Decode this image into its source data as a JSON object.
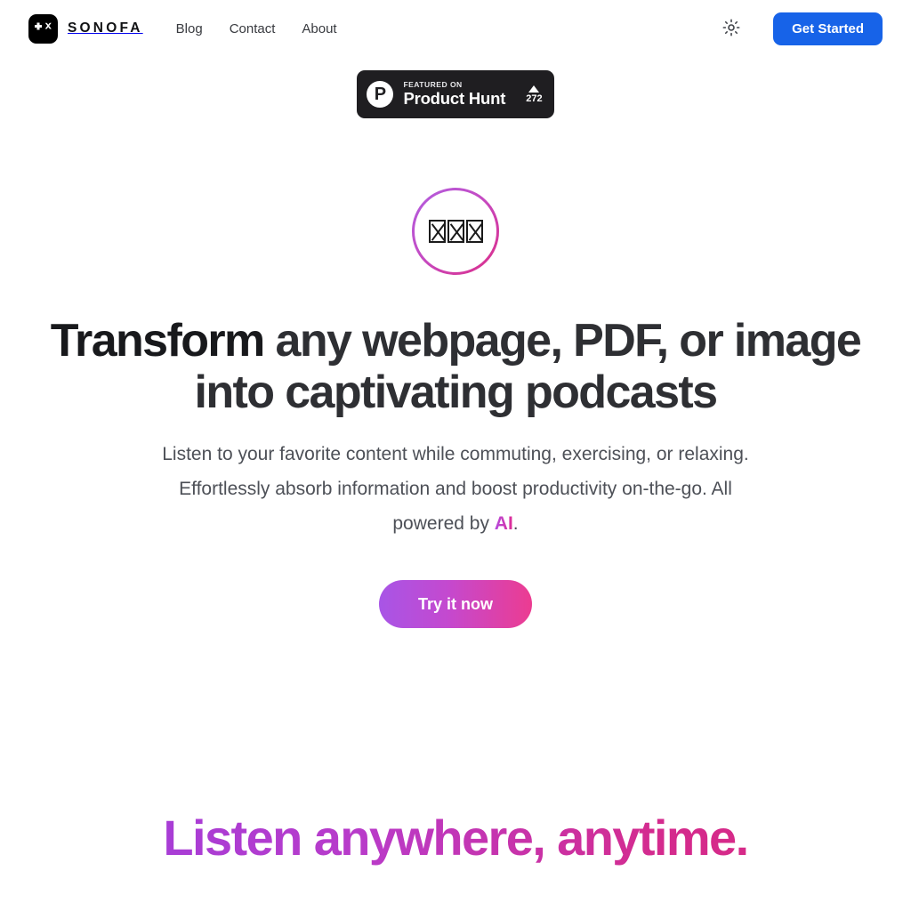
{
  "brand": {
    "name": "SONOFA",
    "logo_icon": "plus-x-logo-icon"
  },
  "nav": {
    "items": [
      {
        "label": "Blog"
      },
      {
        "label": "Contact"
      },
      {
        "label": "About"
      }
    ]
  },
  "header": {
    "theme_toggle_icon": "sun-icon",
    "cta_label": "Get Started",
    "cta_color": "#1763e8"
  },
  "product_hunt": {
    "eyebrow": "FEATURED ON",
    "title": "Product Hunt",
    "logo_letter": "P",
    "upvote_icon": "triangle-up-icon",
    "upvote_count": "272",
    "background": "#1f1e21"
  },
  "hero": {
    "avatar_glyphs": "",
    "title_lead": "Transform",
    "title_rest": " any webpage, PDF, or image into captivating podcasts",
    "subtitle_part1": "Listen to your favorite content while commuting, exercising, or relaxing. Effortlessly absorb information and boost productivity on-the-go. All powered by ",
    "subtitle_highlight": "AI",
    "subtitle_part2": ".",
    "cta_label": "Try it now",
    "gradient_start": "#a855e6",
    "gradient_end": "#ec3c91"
  },
  "section2": {
    "title": "Listen anywhere, anytime."
  }
}
